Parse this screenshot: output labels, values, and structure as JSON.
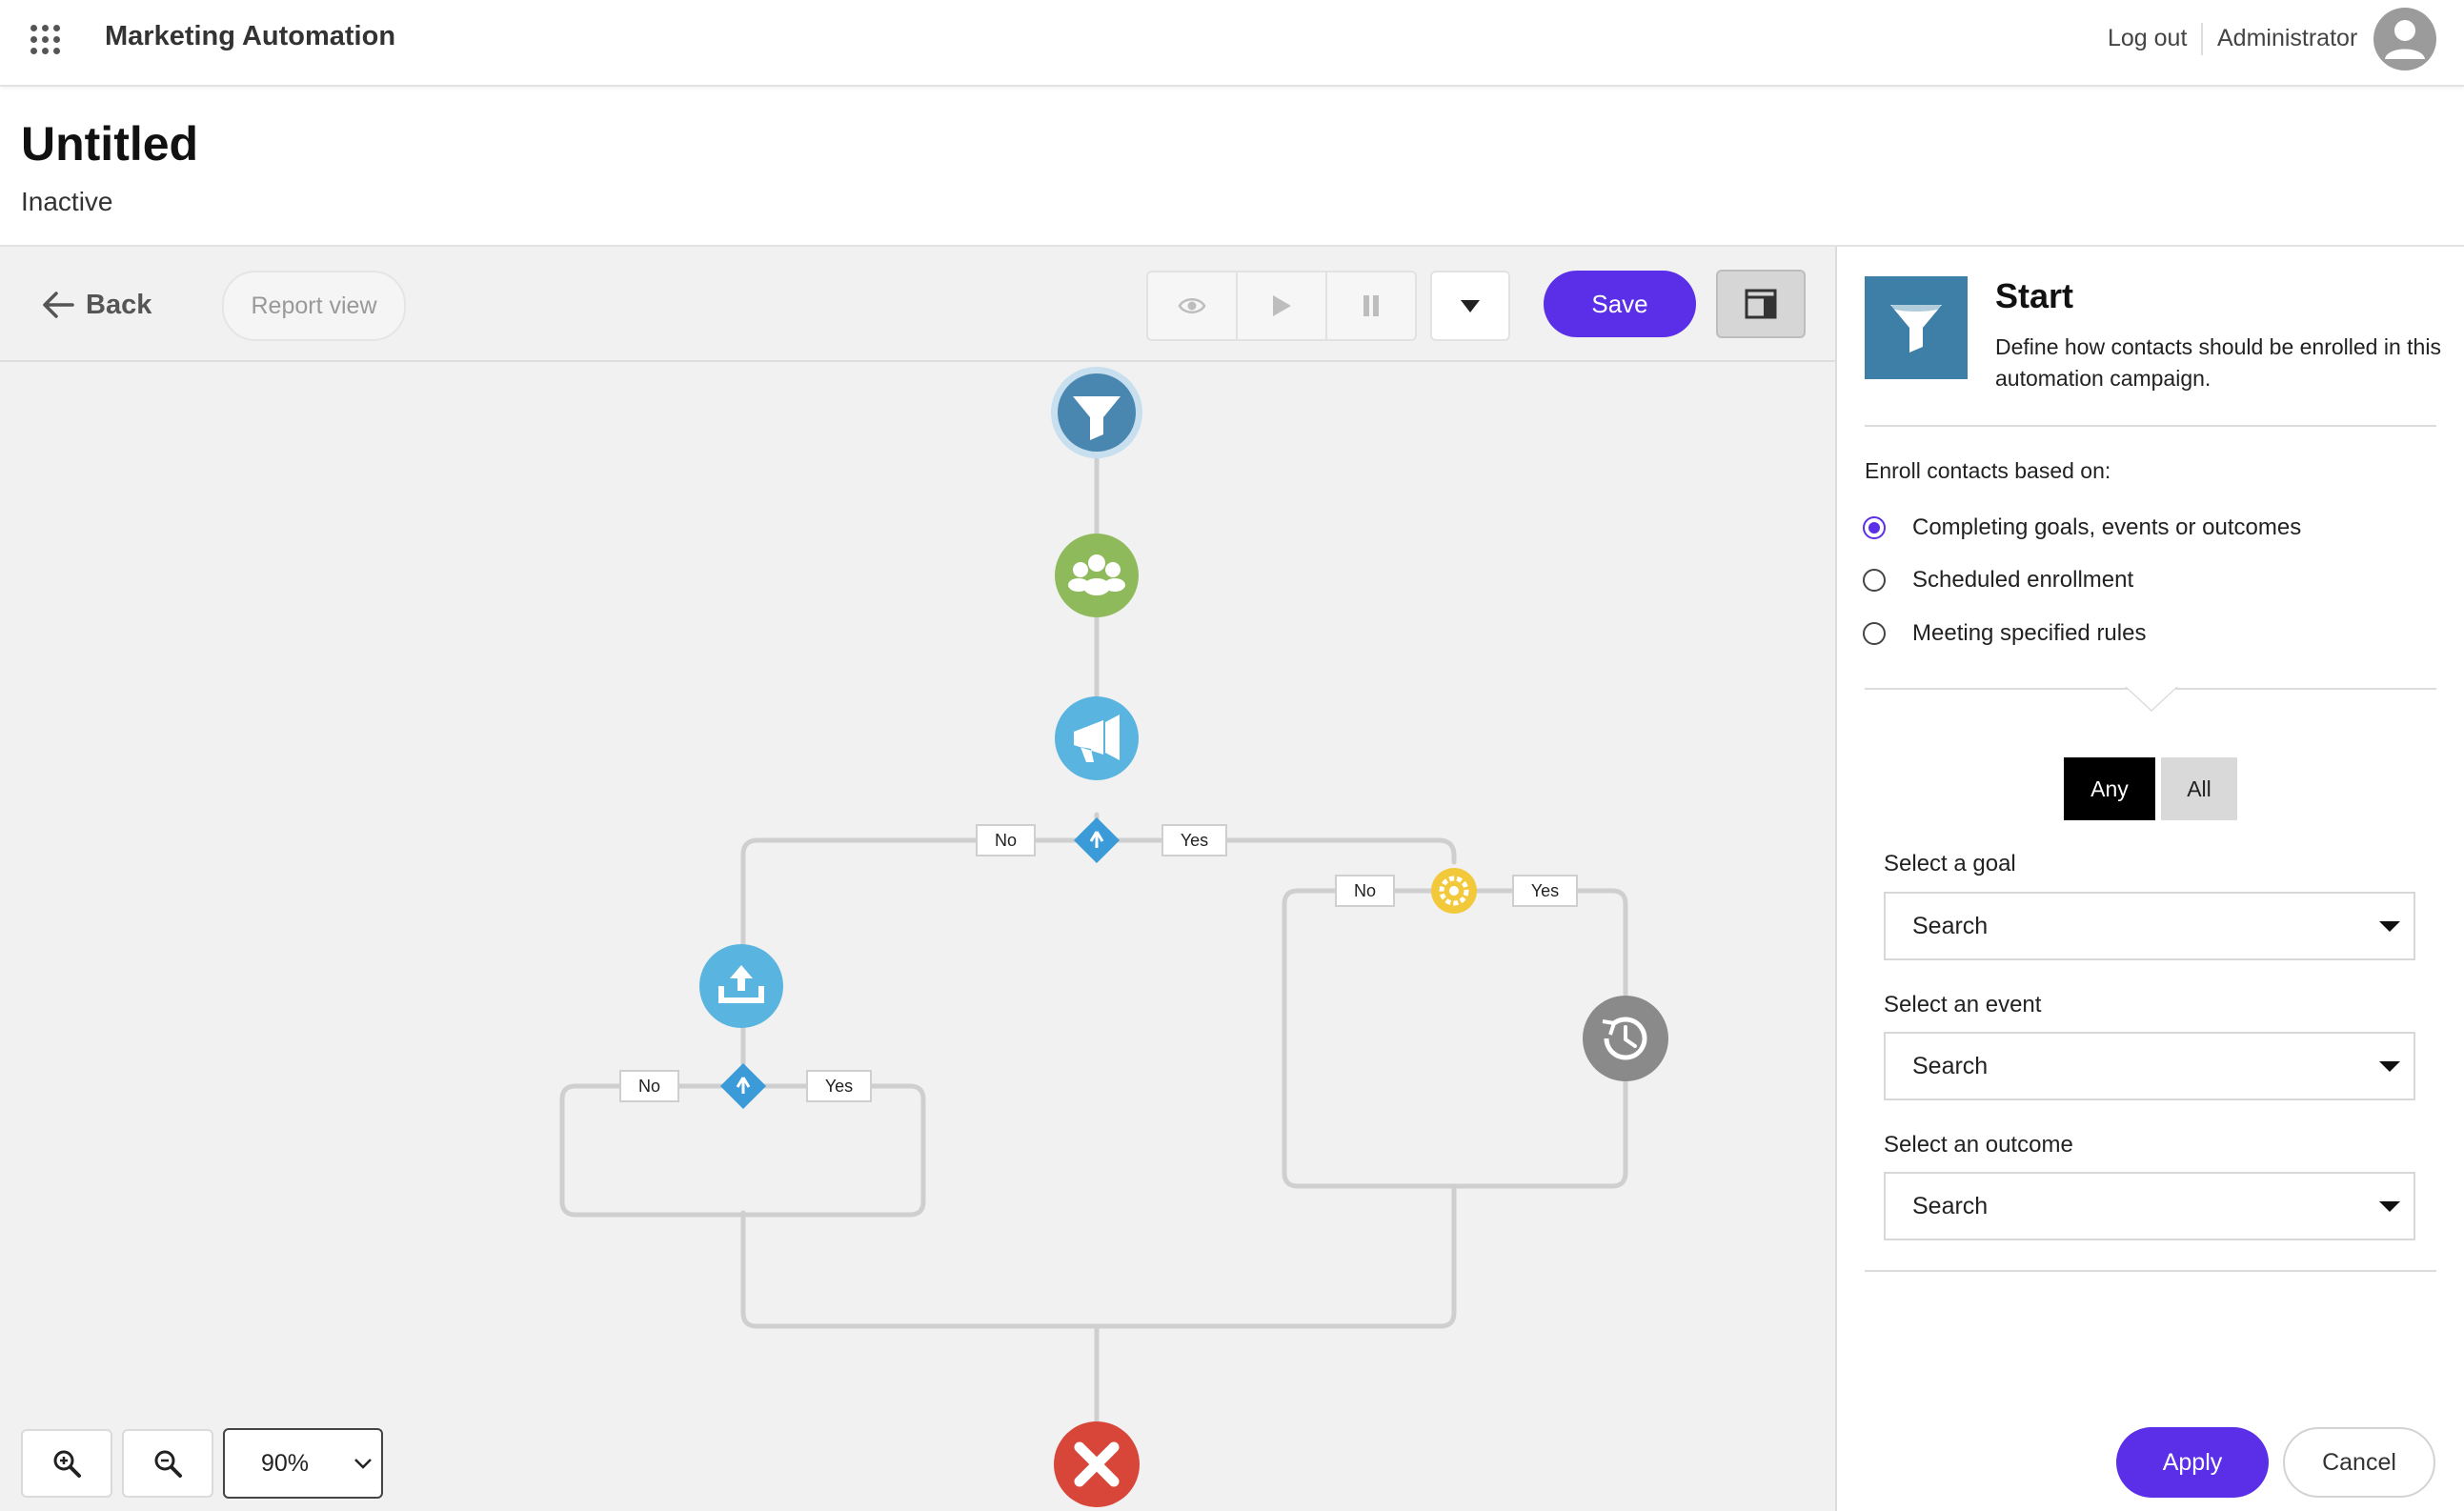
{
  "header": {
    "app_name": "Marketing Automation",
    "logout_label": "Log out",
    "user_label": "Administrator"
  },
  "page": {
    "title": "Untitled",
    "status": "Inactive"
  },
  "toolbar": {
    "back_label": "Back",
    "report_label": "Report view",
    "save_label": "Save"
  },
  "flow": {
    "labels": {
      "d1_no": "No",
      "d1_yes": "Yes",
      "d2_no": "No",
      "d2_yes": "Yes",
      "d3_no": "No",
      "d3_yes": "Yes"
    }
  },
  "zoom": {
    "value": "90%"
  },
  "panel": {
    "title": "Start",
    "description": "Define how contacts should be enrolled in this automation campaign.",
    "enroll_label": "Enroll contacts based on:",
    "options": [
      {
        "label": "Completing goals, events or outcomes",
        "selected": true
      },
      {
        "label": "Scheduled enrollment",
        "selected": false
      },
      {
        "label": "Meeting specified rules",
        "selected": false
      }
    ],
    "toggle": {
      "any": "Any",
      "all": "All",
      "active": "Any"
    },
    "fields": [
      {
        "label": "Select a goal",
        "value": "Search"
      },
      {
        "label": "Select an event",
        "value": "Search"
      },
      {
        "label": "Select an outcome",
        "value": "Search"
      }
    ],
    "apply_label": "Apply",
    "cancel_label": "Cancel"
  },
  "colors": {
    "accent": "#5b2ee8",
    "start_node": "#3d7fa6",
    "audience_node": "#8fba5b",
    "campaign_node": "#5ab4e0",
    "decision_node": "#3a9bd8",
    "goal_node": "#f3c93c",
    "wait_node": "#8a8a8a",
    "end_node": "#d8463a",
    "connector": "#cfcfcf"
  }
}
